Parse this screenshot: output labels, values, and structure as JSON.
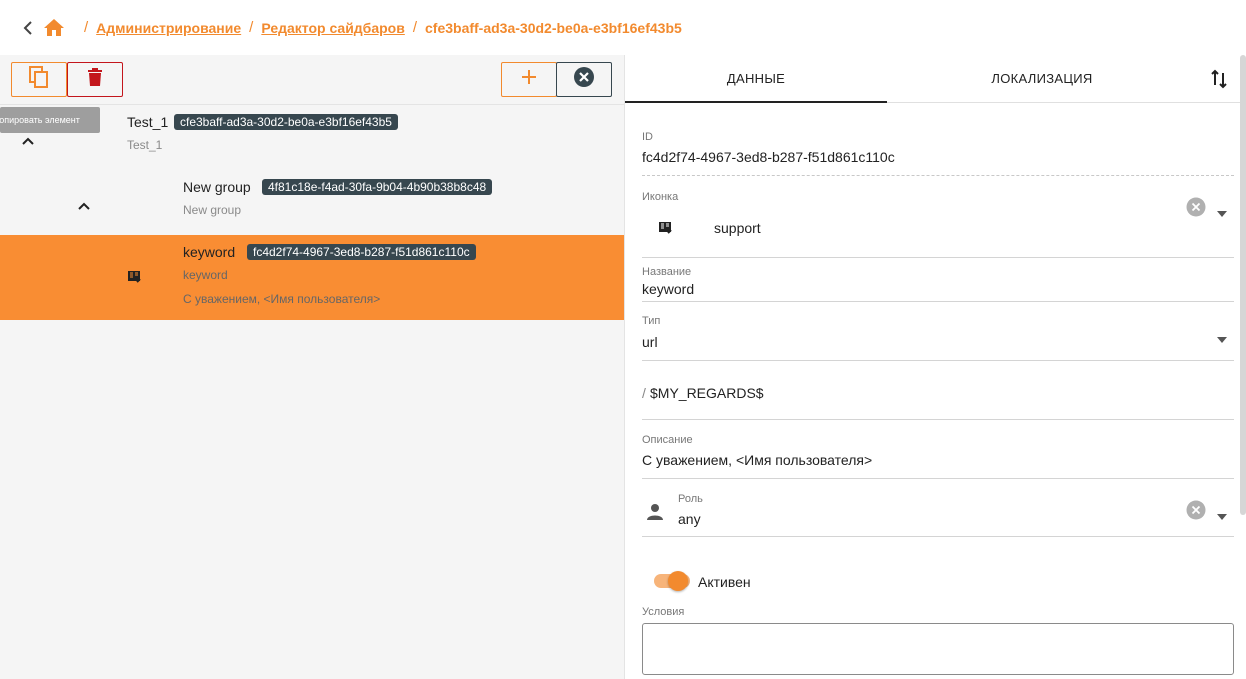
{
  "breadcrumb": {
    "items": [
      {
        "label": "Администрирование"
      },
      {
        "label": "Редактор сайдбаров"
      }
    ],
    "separator": "/",
    "current": "cfe3baff-ad3a-30d2-be0a-e3bf16ef43b5"
  },
  "toolbar": {
    "copy_tooltip": "Копировать элемент"
  },
  "tree": [
    {
      "title": "Test_1",
      "id": "cfe3baff-ad3a-30d2-be0a-e3bf16ef43b5",
      "subtitle": "Test_1"
    },
    {
      "title": "New group",
      "id": "4f81c18e-f4ad-30fa-9b04-4b90b38b8c48",
      "subtitle": "New group"
    },
    {
      "title": "keyword",
      "id": "fc4d2f74-4967-3ed8-b287-f51d861c110c",
      "subtitle": "keyword",
      "description": "С уважением, <Имя пользователя>",
      "icon": "support-icon",
      "selected": true
    }
  ],
  "tabs": [
    {
      "label": "ДАННЫЕ",
      "active": true
    },
    {
      "label": "ЛОКАЛИЗАЦИЯ",
      "active": false
    }
  ],
  "form": {
    "id_label": "ID",
    "id_value": "fc4d2f74-4967-3ed8-b287-f51d861c110c",
    "icon_label": "Иконка",
    "icon_value": "support",
    "name_label": "Название",
    "name_value": "keyword",
    "type_label": "Тип",
    "type_value": "url",
    "url_prefix": "/",
    "url_value": "$MY_REGARDS$",
    "desc_label": "Описание",
    "desc_value": "С уважением, <Имя пользователя>",
    "role_label": "Роль",
    "role_value": "any",
    "active_label": "Активен",
    "active_on": true,
    "conditions_label": "Условия",
    "conditions_value": ""
  },
  "colors": {
    "accent": "#f28a2e",
    "selected_row": "#f98d33",
    "chip": "#37474f",
    "danger": "#c3161c"
  }
}
